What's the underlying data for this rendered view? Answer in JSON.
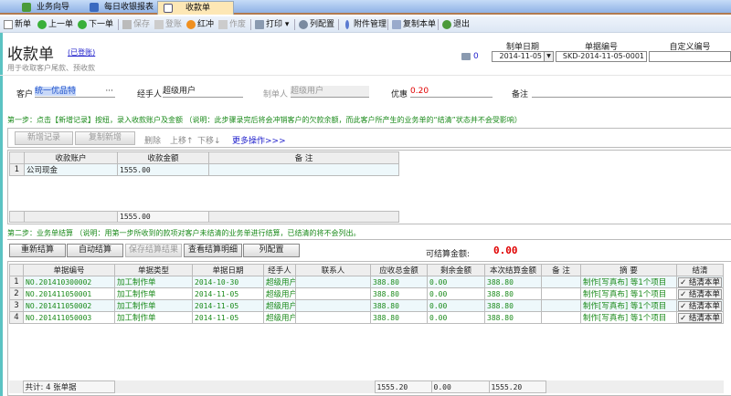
{
  "tabs": [
    {
      "label": "业务向导",
      "icon": "home-icon"
    },
    {
      "label": "每日收银报表",
      "icon": "report-icon"
    },
    {
      "label": "收款单",
      "icon": "document-icon",
      "active": true
    }
  ],
  "toolbar": {
    "new": "新单",
    "prev": "上一单",
    "next": "下一单",
    "save": "保存",
    "post": "登账",
    "reverse": "红冲",
    "void": "作废",
    "print": "打印",
    "columns": "列配置",
    "attachments": "附件管理",
    "copy": "复制本单",
    "exit": "退出"
  },
  "header": {
    "title": "收款单",
    "status": "(已登账)",
    "subtitle": "用于收取客户尾款、预收款",
    "print_count": "0",
    "date_label": "制单日期",
    "date_value": "2014-11-05",
    "number_label": "单据编号",
    "number_value": "SKD-2014-11-05-0001",
    "custom_label": "自定义编号",
    "custom_value": ""
  },
  "form": {
    "customer_label": "客户",
    "customer_value": "统一优品特",
    "handler_label": "经手人",
    "handler_value": "超级用户",
    "creator_label": "制单人",
    "creator_value": "超级用户",
    "discount_label": "优惠",
    "discount_value": "0.20",
    "remark_label": "备注",
    "remark_value": ""
  },
  "step1": {
    "text": "第一步：点击【新增记录】按纽，录入收款账户及金额 （说明：此步骤录完后将会冲销客户的欠款余额，而此客户所产生的业务单的“结清”状态并不会受影响）",
    "add": "新增记录",
    "copy_add": "复制新增",
    "delete": "删除",
    "up": "上移↑",
    "down": "下移↓",
    "more": "更多操作>>>",
    "columns": [
      "收款账户",
      "收款金额",
      "备 注"
    ],
    "rows": [
      {
        "n": "1",
        "account": "公司现金",
        "amount": "1555.00",
        "remark": ""
      }
    ],
    "total": "1555.00"
  },
  "step2": {
    "text": "第二步：业务单结算 （说明：用第一步所收到的款项对客户未结清的业务单进行结算，已结清的将不会列出。",
    "recalc": "重新结算",
    "auto": "自动结算",
    "save": "保存结算结果",
    "detail": "查看结算明细",
    "columns_btn": "列配置",
    "available_label": "可结算金额:",
    "available_value": "0.00",
    "columns": [
      "单据编号",
      "单据类型",
      "单据日期",
      "经手人",
      "联系人",
      "应收总金额",
      "剩余金额",
      "本次结算金额",
      "备 注",
      "摘 要",
      "结清"
    ],
    "rows": [
      {
        "n": "1",
        "no": "NO.201410300002",
        "type": "加工制作单",
        "date": "2014-10-30",
        "handler": "超级用户",
        "contact": "",
        "due": "388.80",
        "rest": "0.00",
        "this": "388.80",
        "remark": "",
        "summary": "制作[写真布] 等1个项目",
        "settle": "✓ 结清本单"
      },
      {
        "n": "2",
        "no": "NO.201411050001",
        "type": "加工制作单",
        "date": "2014-11-05",
        "handler": "超级用户",
        "contact": "",
        "due": "388.80",
        "rest": "0.00",
        "this": "388.80",
        "remark": "",
        "summary": "制作[写真布] 等1个项目",
        "settle": "✓ 结清本单"
      },
      {
        "n": "3",
        "no": "NO.201411050002",
        "type": "加工制作单",
        "date": "2014-11-05",
        "handler": "超级用户",
        "contact": "",
        "due": "388.80",
        "rest": "0.00",
        "this": "388.80",
        "remark": "",
        "summary": "制作[写真布] 等1个项目",
        "settle": "✓ 结清本单"
      },
      {
        "n": "4",
        "no": "NO.201411050003",
        "type": "加工制作单",
        "date": "2014-11-05",
        "handler": "超级用户",
        "contact": "",
        "due": "388.80",
        "rest": "0.00",
        "this": "388.80",
        "remark": "",
        "summary": "制作[写真布] 等1个项目",
        "settle": "✓ 结清本单"
      }
    ],
    "footer": {
      "count": "共计: 4 张单据",
      "due": "1555.20",
      "rest": "0.00",
      "this": "1555.20"
    }
  },
  "colors": {
    "accent_green": "#1a8a1a",
    "amount_red": "#e00000",
    "link_blue": "#2222cc"
  }
}
